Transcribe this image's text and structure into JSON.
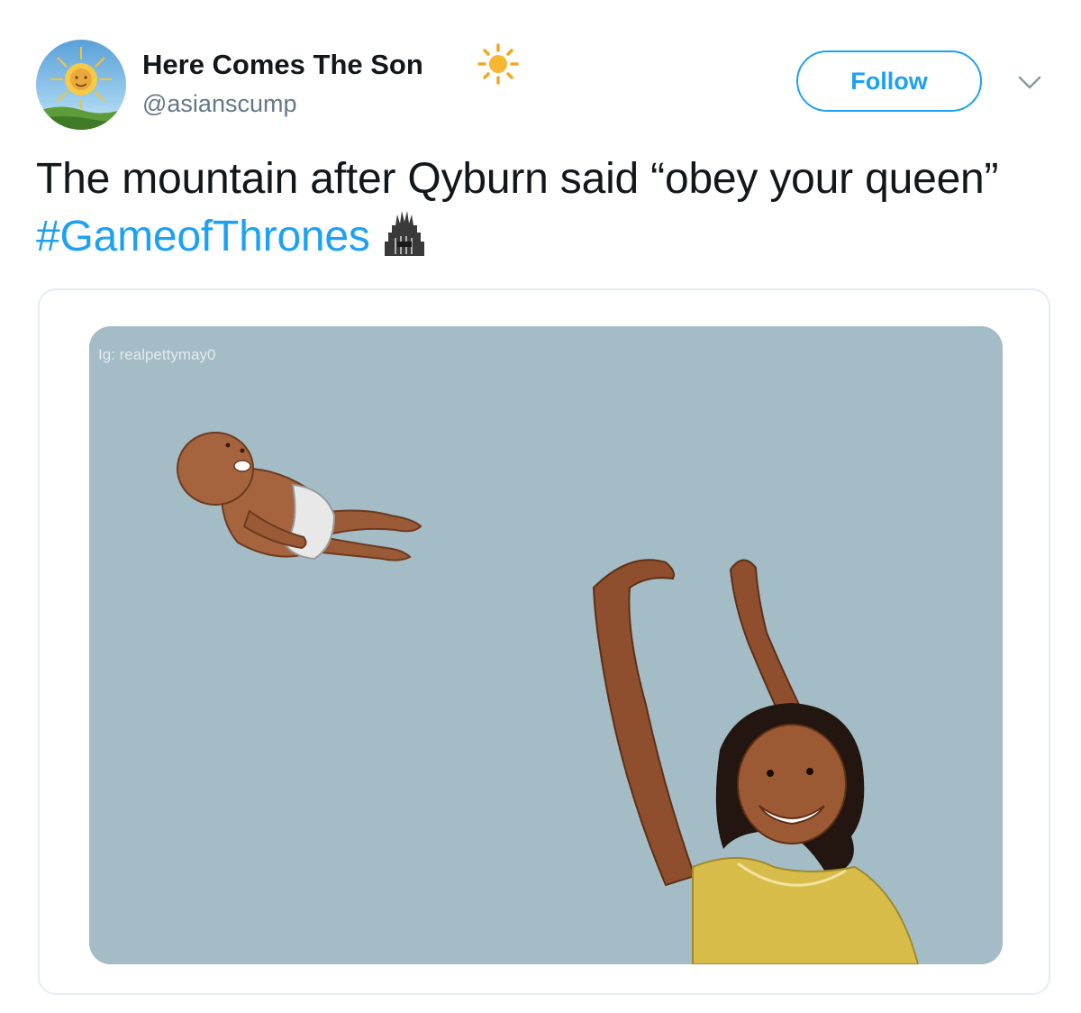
{
  "author": {
    "display_name": "Here Comes The Son",
    "name_emoji": "sun-emoji",
    "handle": "@asianscump"
  },
  "actions": {
    "follow_label": "Follow",
    "menu_icon": "chevron-down-icon"
  },
  "tweet": {
    "text_before": "The mountain after Qyburn said “obey your queen” ",
    "hashtag": "#GameofThrones",
    "trailing_emoji": "iron-throne-icon"
  },
  "media": {
    "watermark": "Ig: realpettymay0",
    "background_color": "#a3bcc6"
  },
  "colors": {
    "accent": "#1da1f2",
    "text": "#14171a",
    "secondary_text": "#657786",
    "card_border": "#e6ecf0"
  }
}
